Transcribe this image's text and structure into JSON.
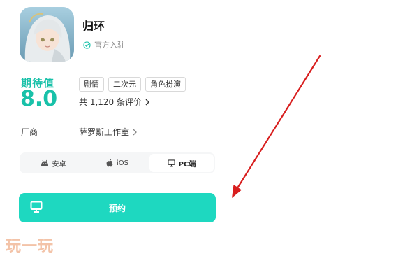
{
  "game": {
    "title": "归环",
    "verified_text": "官方入驻"
  },
  "rating": {
    "label": "期待值",
    "score": "8.0",
    "tags": [
      "剧情",
      "二次元",
      "角色扮演"
    ],
    "reviews": "共 1,120 条评价"
  },
  "vendor": {
    "label": "厂商",
    "name": "萨罗斯工作室"
  },
  "platforms": {
    "tabs": [
      {
        "label": "安卓",
        "icon": "android-icon"
      },
      {
        "label": "iOS",
        "icon": "apple-icon"
      },
      {
        "label": "PC端",
        "icon": "monitor-icon"
      }
    ],
    "selected": "PC端"
  },
  "reserve_button": {
    "label": "预约",
    "icon": "monitor-icon"
  },
  "watermark": "玩一玩",
  "colors": {
    "accent": "#19c1a9",
    "button": "#1ed8c0",
    "annotation_arrow": "#d81e1e"
  }
}
